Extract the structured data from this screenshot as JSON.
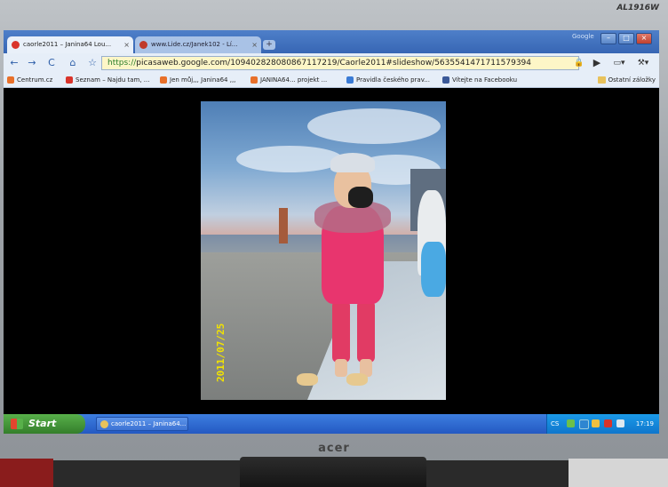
{
  "monitor": {
    "model": "AL1916W",
    "brand": "acer"
  },
  "browser": {
    "tabs": [
      {
        "label": "caorle2011 – Janina64 Lou...",
        "active": true,
        "favicon_color": "#d9342b"
      },
      {
        "label": "www.Lide.cz/Janek102 - Lí...",
        "active": false,
        "favicon_color": "#c0392b"
      }
    ],
    "close_glyph": "×",
    "newtab_glyph": "+",
    "google_label": "Google",
    "window_controls": {
      "minimize": "–",
      "maximize": "□",
      "close": "×"
    },
    "nav": {
      "back": "←",
      "forward": "→",
      "reload": "C",
      "home": "⌂",
      "star": "☆"
    },
    "address": {
      "scheme": "https://",
      "rest": "picasaweb.google.com/109402828080867117219/Caorle2011#slideshow/5635541471711579394",
      "lock": "🔒"
    },
    "toolbar_right": {
      "play": "▶",
      "page": "▭▾",
      "tools": "⚒▾"
    },
    "bookmarks": [
      {
        "label": "Centrum.cz",
        "color": "#e8702a"
      },
      {
        "label": "Seznam – Najdu tam, ...",
        "color": "#d9342b"
      },
      {
        "label": "Jen můj,,, Janina64 ,,,",
        "color": "#e8702a"
      },
      {
        "label": "JANINA64... projekt ...",
        "color": "#e8702a"
      },
      {
        "label": "Pravidla českého prav...",
        "color": "#3a7bd5"
      },
      {
        "label": "Vítejte na Facebooku",
        "color": "#3b5998"
      }
    ],
    "other_bookmarks": "Ostatní záložky"
  },
  "photo": {
    "date_stamp": "2011/07/25"
  },
  "taskbar": {
    "start_label": "Start",
    "task_label": "caorle2011 – Janina64...",
    "language": "CS",
    "clock": "17:19"
  }
}
